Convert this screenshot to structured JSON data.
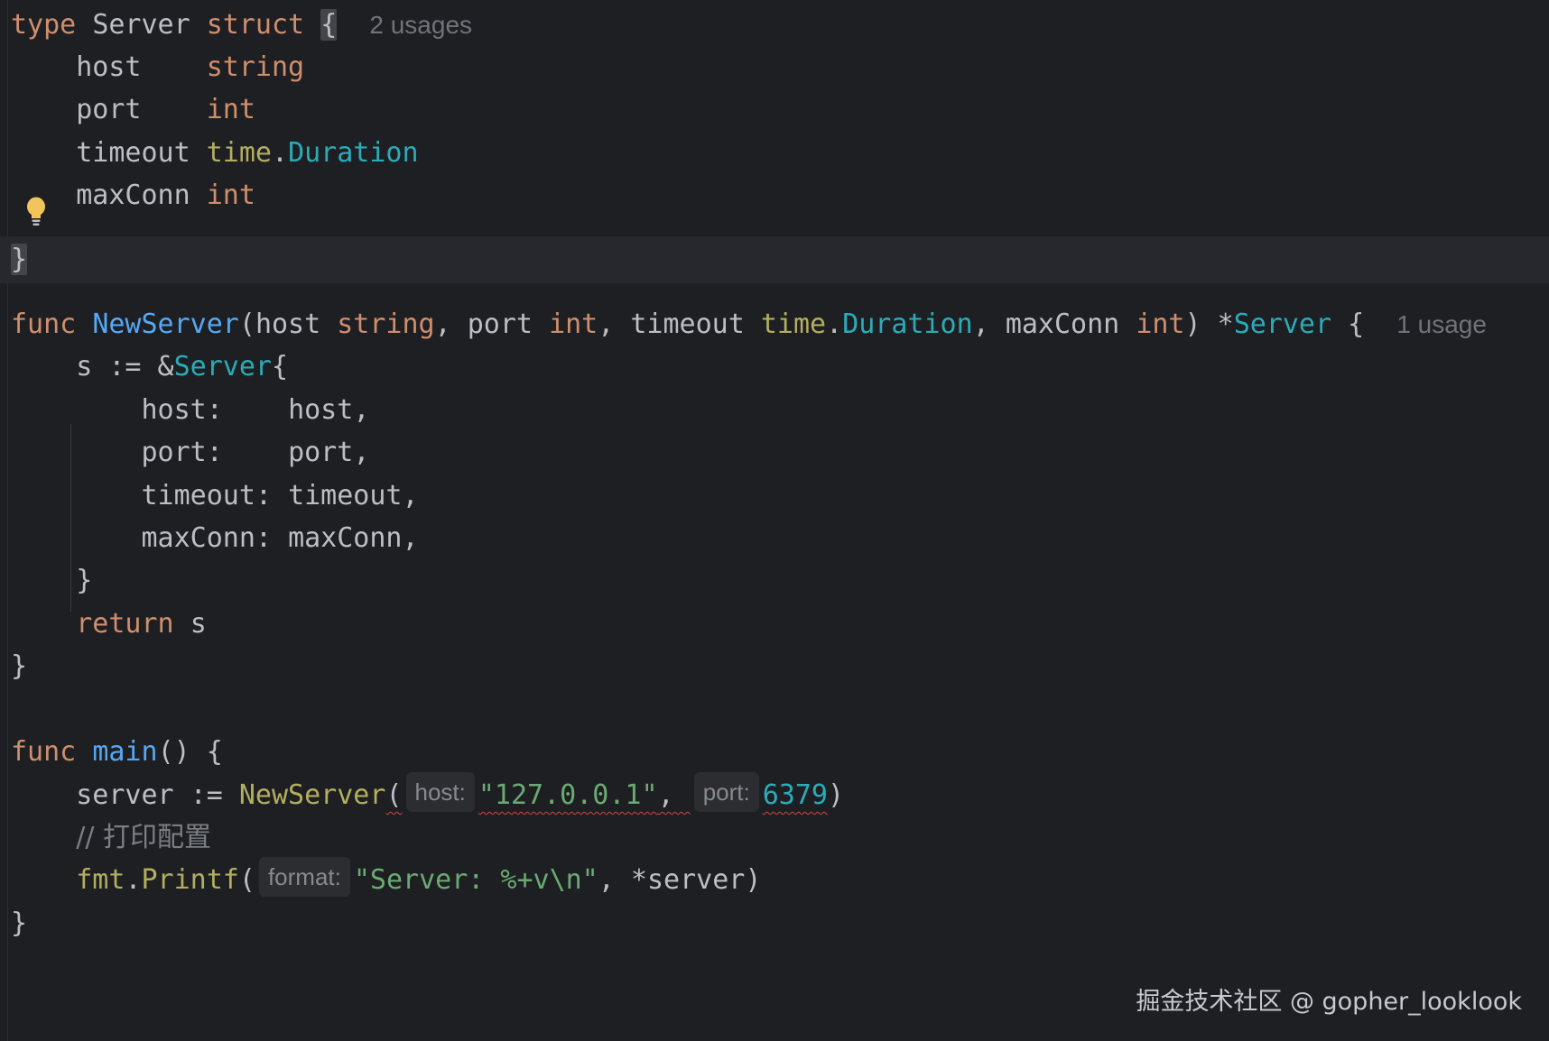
{
  "editor": {
    "inlay": {
      "struct_usages": "2 usages",
      "func_usages": "1 usage",
      "hint_host": "host:",
      "hint_port": "port:",
      "hint_format": "format:"
    },
    "tokens": {
      "type": "type",
      "struct": "struct",
      "func": "func",
      "return": "return",
      "Server": "Server",
      "NewServer": "NewServer",
      "main": "main",
      "host": "host",
      "port": "port",
      "timeout": "timeout",
      "maxConn": "maxConn",
      "string": "string",
      "int": "int",
      "time": "time",
      "Duration": "Duration",
      "fmt": "fmt",
      "Printf": "Printf",
      "s": "s",
      "server": "server",
      "host_str": "\"127.0.0.1\"",
      "port_num": "6379",
      "format_str": "\"Server: %+v\\n\"",
      "comment": "// 打印配置"
    }
  },
  "watermark": "掘金技术社区 @ gopher_looklook",
  "icons": {
    "intention": "lightbulb-icon"
  },
  "colors": {
    "background": "#1e1f22",
    "keyword": "#cf8e6d",
    "function": "#56a8f5",
    "type": "#2aacb8",
    "string": "#6aab73",
    "package": "#b3ae60"
  }
}
